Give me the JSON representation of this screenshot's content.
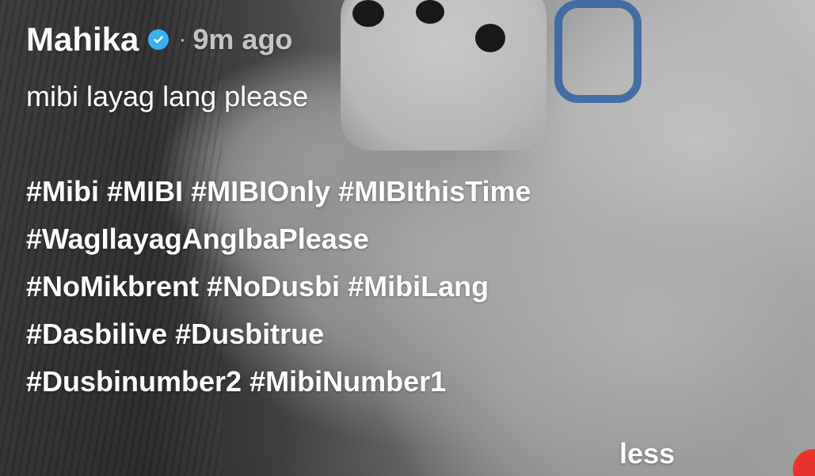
{
  "post": {
    "username": "Mahika",
    "verified_icon": "verified-check-icon",
    "separator": "·",
    "time_ago": "9m ago",
    "caption": "mibi layag lang please",
    "hashtag_lines": [
      [
        "#Mibi",
        "#MIBI",
        "#MIBIOnly",
        "#MIBIthisTime"
      ],
      [
        "#WagIlayagAngIbaPlease"
      ],
      [
        "#NoMikbrent",
        "#NoDusbi",
        "#MibiLang"
      ],
      [
        "#Dasbilive",
        "#Dusbitrue"
      ],
      [
        "#Dusbinumber2",
        "#MibiNumber1"
      ]
    ],
    "less_label": "less"
  },
  "colors": {
    "verified_badge": "#3bb2f0",
    "text": "#ffffff",
    "muted_text": "rgba(255,255,255,0.72)"
  }
}
